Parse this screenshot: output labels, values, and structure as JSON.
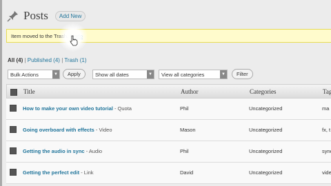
{
  "header": {
    "title": "Posts",
    "add_new": "Add New"
  },
  "notice": {
    "text": "Item moved to the Trash.",
    "undo": "Undo"
  },
  "status_filters": [
    {
      "label": "All",
      "count": "(4)"
    },
    {
      "label": "Published",
      "count": "(4)"
    },
    {
      "label": "Trash",
      "count": "(1)"
    }
  ],
  "controls": {
    "bulk_actions": "Bulk Actions",
    "apply": "Apply",
    "dates": "Show all dates",
    "categories": "View all categories",
    "filter": "Filter"
  },
  "table": {
    "columns": [
      "Title",
      "Author",
      "Categories",
      "Tag"
    ],
    "rows": [
      {
        "title": "How to make your own video tutorial",
        "format": "- Quota",
        "author": "Phil",
        "category": "Uncategorized",
        "tags": "ma"
      },
      {
        "title": "Going overboard with effects",
        "format": "- Video",
        "author": "Mason",
        "category": "Uncategorized",
        "tags": "fx, t"
      },
      {
        "title": "Getting the audio in sync",
        "format": "- Audio",
        "author": "Phil",
        "category": "Uncategorized",
        "tags": "sync"
      },
      {
        "title": "Getting the perfect edit",
        "format": "- Link",
        "author": "David",
        "category": "Uncategorized",
        "tags": "vide"
      }
    ]
  }
}
